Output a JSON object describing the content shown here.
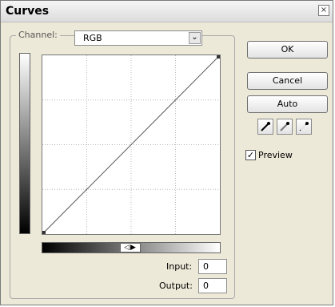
{
  "window": {
    "title": "Curves",
    "close_glyph": "×"
  },
  "channel": {
    "label": "Channel:",
    "value": "RGB",
    "arrow_glyph": "⌄"
  },
  "curve": {
    "points": [
      [
        0,
        0
      ],
      [
        255,
        255
      ]
    ]
  },
  "slider_toggle": {
    "glyph": "◁▶"
  },
  "fields": {
    "input_label": "Input:",
    "input_value": "0",
    "output_label": "Output:",
    "output_value": "0"
  },
  "buttons": {
    "ok": "OK",
    "cancel": "Cancel",
    "auto": "Auto"
  },
  "eyedroppers": [
    "black-eyedropper-icon",
    "gray-eyedropper-icon",
    "white-eyedropper-icon"
  ],
  "preview": {
    "label": "Preview",
    "checked": true,
    "check_glyph": "✓"
  }
}
